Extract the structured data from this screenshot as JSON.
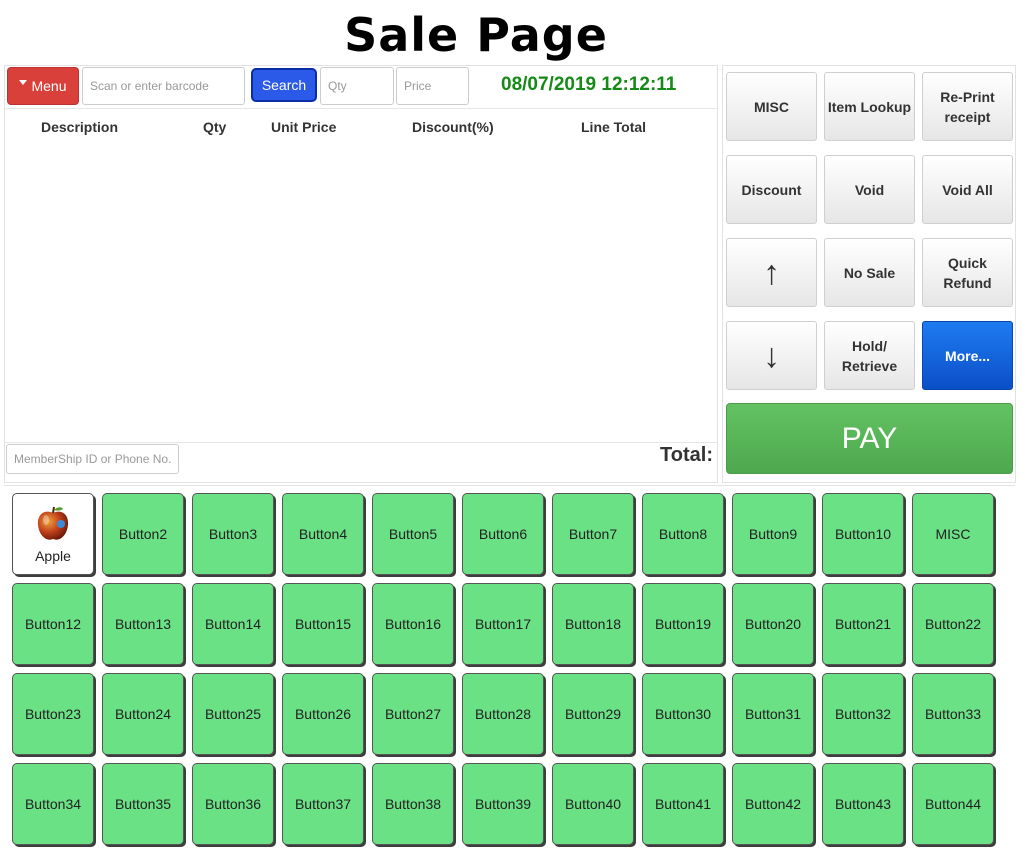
{
  "title": "Sale Page",
  "toolbar": {
    "menu_label": "Menu",
    "barcode_placeholder": "Scan or enter barcode",
    "search_label": "Search",
    "qty_placeholder": "Qty",
    "price_placeholder": "Price",
    "datetime": "08/07/2019 12:12:11"
  },
  "table": {
    "columns": [
      "Description",
      "Qty",
      "Unit Price",
      "Discount(%)",
      "Line Total"
    ]
  },
  "footer": {
    "member_placeholder": "MemberShip ID or Phone No.",
    "total_label": "Total:"
  },
  "functions": {
    "misc": "MISC",
    "item_lookup": "Item Lookup",
    "reprint": "Re-Print receipt",
    "discount": "Discount",
    "void": "Void",
    "void_all": "Void All",
    "up": "↑",
    "no_sale": "No Sale",
    "quick_refund": "Quick Refund",
    "down": "↓",
    "hold_retrieve": "Hold/ Retrieve",
    "more": "More...",
    "pay": "PAY"
  },
  "items": [
    "Apple",
    "Button2",
    "Button3",
    "Button4",
    "Button5",
    "Button6",
    "Button7",
    "Button8",
    "Button9",
    "Button10",
    "MISC",
    "Button12",
    "Button13",
    "Button14",
    "Button15",
    "Button16",
    "Button17",
    "Button18",
    "Button19",
    "Button20",
    "Button21",
    "Button22",
    "Button23",
    "Button24",
    "Button25",
    "Button26",
    "Button27",
    "Button28",
    "Button29",
    "Button30",
    "Button31",
    "Button32",
    "Button33",
    "Button34",
    "Button35",
    "Button36",
    "Button37",
    "Button38",
    "Button39",
    "Button40",
    "Button41",
    "Button42",
    "Button43",
    "Button44"
  ],
  "colors": {
    "menu": "#d9403a",
    "search": "#2b5ae8",
    "datetime": "#168a16",
    "more": "#0b4fc8",
    "pay": "#58b558",
    "item_tile": "#6be186"
  }
}
